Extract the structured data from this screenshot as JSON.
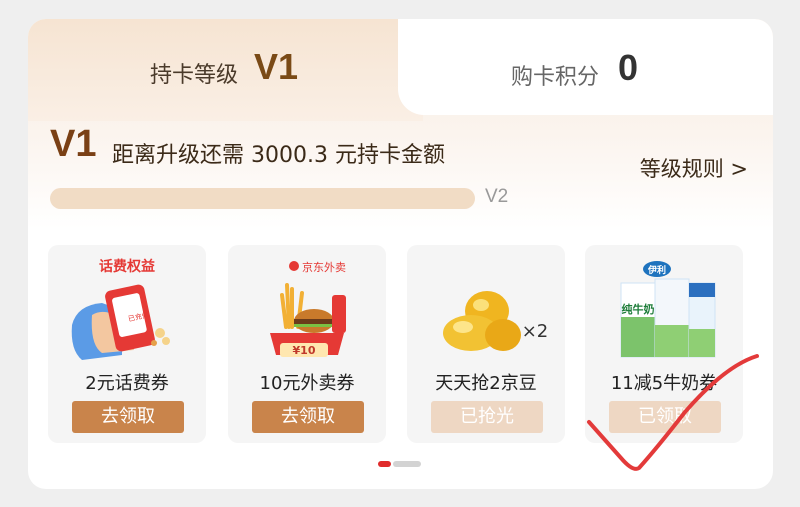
{
  "tabs": {
    "level": {
      "label": "持卡等级",
      "value": "V1"
    },
    "points": {
      "label": "购卡积分",
      "value": "0"
    }
  },
  "progress": {
    "current_level": "V1",
    "upgrade_text": "距离升级还需 3000.3 元持卡金额",
    "rules_link": "等级规则 >",
    "next_level": "V2",
    "fraction": 0.0
  },
  "coupons": [
    {
      "name": "2元话费券",
      "button": "去领取",
      "state": "available",
      "icon": "phone-credit-image",
      "image_caption": "话费权益"
    },
    {
      "name": "10元外卖券",
      "button": "去领取",
      "state": "available",
      "icon": "food-delivery-image",
      "image_caption": "京东外卖",
      "badge": "¥10"
    },
    {
      "name": "天天抢2京豆",
      "button": "已抢光",
      "state": "sold_out",
      "icon": "jingdou-beans-image",
      "multiplier": "×2"
    },
    {
      "name": "11减5牛奶券",
      "button": "已领取",
      "state": "claimed",
      "icon": "milk-box-image",
      "brand": "伊利",
      "product": "纯牛奶"
    }
  ],
  "pager": {
    "count": 2,
    "active": 1
  },
  "colors": {
    "accent": "#c9844b",
    "accent_disabled": "#eed7c3",
    "level_text": "#7a4015",
    "pager_active": "#e02b2b",
    "annotation": "#e33a3a"
  }
}
